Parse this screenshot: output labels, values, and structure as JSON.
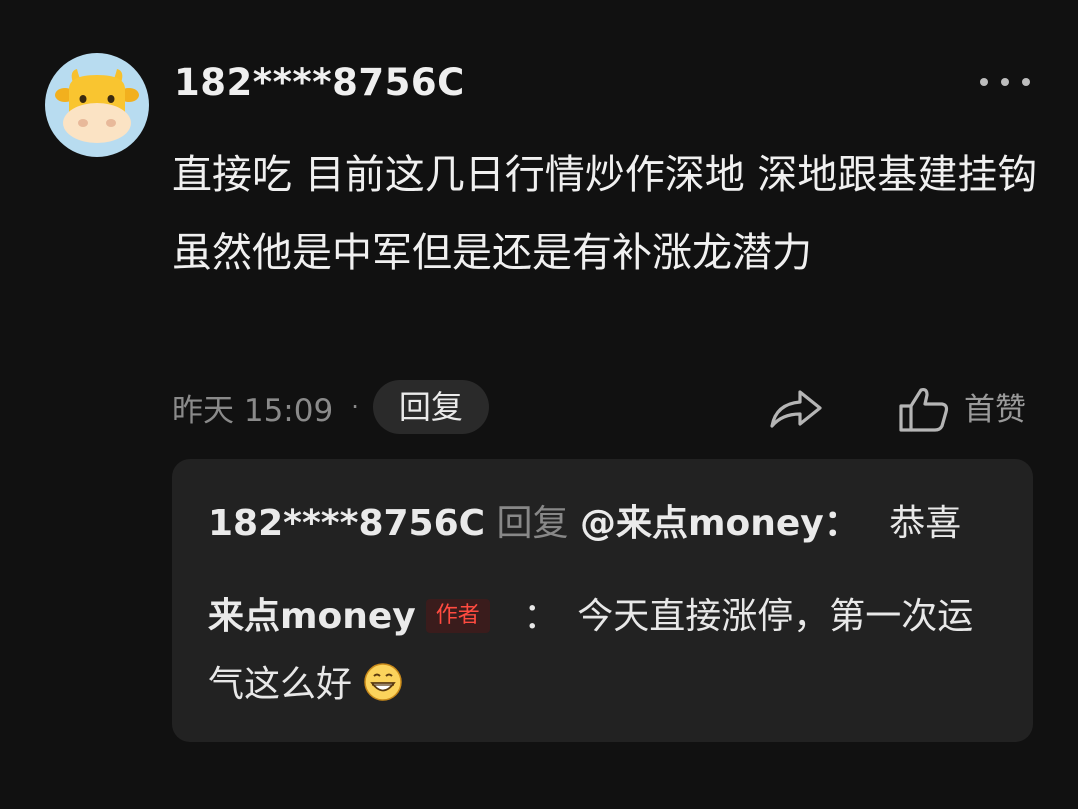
{
  "comment": {
    "username": "182****8756C",
    "text": "直接吃 目前这几日行情炒作深地 深地跟基建挂钩 虽然他是中军但是还是有补涨龙潜力",
    "time": "昨天 15:09",
    "separator": "·",
    "reply_label": "回复",
    "like_label": "首赞"
  },
  "replies": [
    {
      "from": "182****8756C",
      "verb": "回复",
      "to": "@来点money：",
      "text": "恭喜"
    },
    {
      "from": "来点money",
      "tag": "作者",
      "colon": "：",
      "text": "今天直接涨停，第一次运气这么好",
      "emoji": "grinning-face-icon"
    }
  ],
  "colors": {
    "background": "#111111",
    "reply_box": "#222222",
    "author_tag": "#ff4b40",
    "avatar_bg": "#b8dcf0"
  }
}
